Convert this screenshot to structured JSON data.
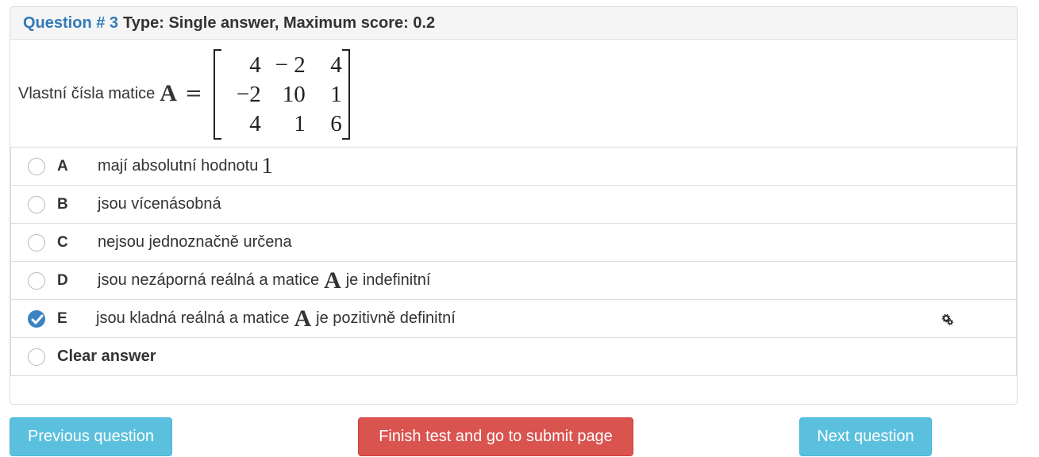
{
  "question": {
    "number_label": "Question # 3",
    "type_label": "Type: Single answer, Maximum score: 0.2",
    "text": "Vlastní čísla matice",
    "matrix_symbol": "A",
    "equals": "=",
    "matrix": [
      [
        "4",
        "− 2",
        "4"
      ],
      [
        "−2",
        "10",
        "1"
      ],
      [
        "4",
        "1",
        "6"
      ]
    ]
  },
  "options": [
    {
      "letter": "A",
      "text": "mají absolutní hodnotu",
      "math": "1",
      "checked": false
    },
    {
      "letter": "B",
      "text": "jsou vícenásobná",
      "checked": false
    },
    {
      "letter": "C",
      "text": "nejsou jednoznačně určena",
      "checked": false
    },
    {
      "letter": "D",
      "text_before": "jsou nezáporná reálná a matice",
      "symbol": "A",
      "text_after": "je indefinitní",
      "checked": false
    },
    {
      "letter": "E",
      "text_before": "jsou kladná reálná a matice",
      "symbol": "A",
      "text_after": "je pozitivně definitní",
      "checked": true
    }
  ],
  "clear_answer": "Clear answer",
  "buttons": {
    "previous": "Previous question",
    "finish": "Finish test and go to submit page",
    "next": "Next question"
  },
  "colors": {
    "link_blue": "#337ab7",
    "info": "#5bc0de",
    "danger": "#d9534f",
    "radio_checked": "#3a83c3"
  }
}
